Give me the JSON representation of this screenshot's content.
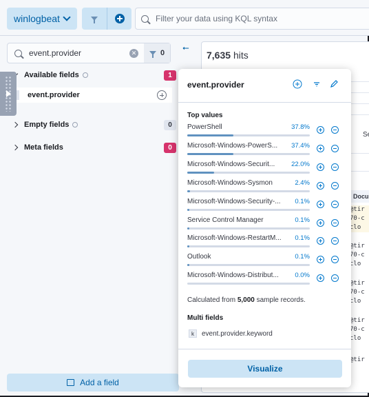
{
  "header": {
    "dataview_label": "winlogbeat",
    "query_placeholder": "Filter your data using KQL syntax"
  },
  "sidebar": {
    "search_value": "event.provider",
    "filter_count": "0",
    "sections": [
      {
        "label": "Available fields",
        "count": "1",
        "expanded": true
      },
      {
        "label": "Empty fields",
        "count": "0",
        "expanded": false
      },
      {
        "label": "Meta fields",
        "count": "0",
        "expanded": false
      }
    ],
    "field": {
      "type": "t",
      "name": "event.provider"
    },
    "add_field_label": "Add a field"
  },
  "main": {
    "hits_count": "7,635",
    "hits_label": "hits",
    "se_text": "Se",
    "doc_header": "Docu",
    "doc_rows": [
      [
        "@tir",
        "70-c",
        "clo"
      ],
      [
        "@tir",
        "70-c",
        "clo"
      ],
      [
        "@tir",
        "70-c",
        "clo"
      ],
      [
        "@tir",
        "70-c",
        "clo"
      ],
      [
        "@tir"
      ]
    ]
  },
  "popover": {
    "title": "event.provider",
    "top_values_title": "Top values",
    "top_values": [
      {
        "name": "PowerShell",
        "pct": "37.8%",
        "frac": 0.378
      },
      {
        "name": "Microsoft-Windows-PowerS...",
        "pct": "37.4%",
        "frac": 0.374
      },
      {
        "name": "Microsoft-Windows-Securit...",
        "pct": "22.0%",
        "frac": 0.22
      },
      {
        "name": "Microsoft-Windows-Sysmon",
        "pct": "2.4%",
        "frac": 0.024
      },
      {
        "name": "Microsoft-Windows-Security-...",
        "pct": "0.1%",
        "frac": 0.001
      },
      {
        "name": "Service Control Manager",
        "pct": "0.1%",
        "frac": 0.001
      },
      {
        "name": "Microsoft-Windows-RestartM...",
        "pct": "0.1%",
        "frac": 0.001
      },
      {
        "name": "Outlook",
        "pct": "0.1%",
        "frac": 0.001
      },
      {
        "name": "Microsoft-Windows-Distribut...",
        "pct": "0.0%",
        "frac": 0.0
      }
    ],
    "calc_prefix": "Calculated from",
    "calc_count": "5,000",
    "calc_suffix": "sample records.",
    "multi_fields_title": "Multi fields",
    "multi_field_type": "k",
    "multi_field_name": "event.provider.keyword",
    "visualize_label": "Visualize"
  },
  "colors": {
    "accent": "#0061a6",
    "accent_light": "#cce4f5",
    "bar_fill": "#6092c0",
    "badge_pink": "#d6336c"
  }
}
